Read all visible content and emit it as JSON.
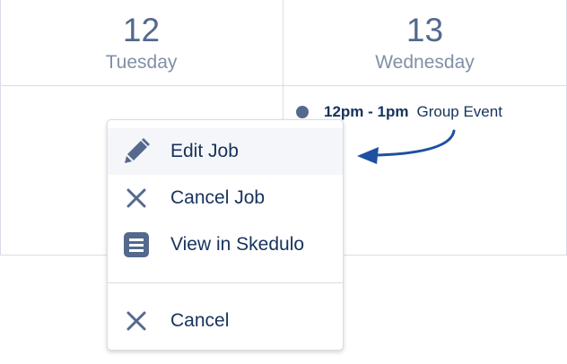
{
  "calendar": {
    "days": [
      {
        "number": "12",
        "name": "Tuesday"
      },
      {
        "number": "13",
        "name": "Wednesday"
      }
    ],
    "event": {
      "time": "12pm - 1pm",
      "title": "Group Event"
    }
  },
  "context_menu": {
    "items": [
      {
        "label": "Edit Job",
        "icon": "pencil-icon"
      },
      {
        "label": "Cancel Job",
        "icon": "close-icon"
      },
      {
        "label": "View in Skedulo",
        "icon": "document-icon"
      },
      {
        "label": "Cancel",
        "icon": "close-icon"
      }
    ]
  },
  "colors": {
    "text_primary": "#16325c",
    "text_secondary": "#54698d",
    "text_muted": "#8190a6",
    "border": "#d8dde6",
    "highlight": "#f4f6f9",
    "arrow": "#1f4fa0"
  }
}
